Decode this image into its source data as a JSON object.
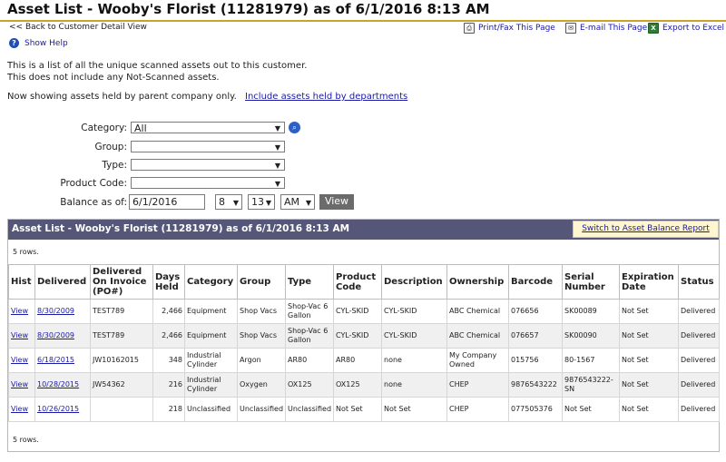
{
  "header": {
    "title": "Asset List - Wooby's Florist (11281979) as of 6/1/2016 8:13 AM",
    "back_link": "<< Back to Customer Detail View",
    "print_label": "Print/Fax This Page",
    "email_label": "E-mail This Page",
    "excel_label": "Export to Excel",
    "help_label": "Show Help"
  },
  "intro": {
    "line1": "This is a list of all the unique scanned assets out to this customer.",
    "line2": "This does not include any Not-Scanned assets.",
    "line3": "Now showing assets held by parent company only.",
    "include_link": "Include assets held by departments"
  },
  "filters": {
    "category_label": "Category:",
    "category_value": "All",
    "group_label": "Group:",
    "group_value": "",
    "type_label": "Type:",
    "type_value": "",
    "product_code_label": "Product Code:",
    "product_code_value": "",
    "balance_label": "Balance as of:",
    "balance_date": "6/1/2016",
    "hour": "8",
    "minute": "13",
    "ampm": "AM",
    "view_button": "View"
  },
  "panel": {
    "title": "Asset List - Wooby's Florist (11281979) as of 6/1/2016 8:13 AM",
    "switch_link": "Switch to Asset Balance Report",
    "rows_count_top": "5 rows.",
    "rows_count_bottom": "5 rows."
  },
  "table": {
    "headers": [
      "Hist",
      "Delivered",
      "Delivered On Invoice (PO#)",
      "Days Held",
      "Category",
      "Group",
      "Type",
      "Product Code",
      "Description",
      "Ownership",
      "Barcode",
      "Serial Number",
      "Expiration Date",
      "Status"
    ],
    "rows": [
      [
        "View",
        "8/30/2009",
        "TEST789",
        "2,466",
        "Equipment",
        "Shop Vacs",
        "Shop-Vac 6 Gallon",
        "CYL-SKID",
        "CYL-SKID",
        "ABC Chemical",
        "076656",
        "SK00089",
        "Not Set",
        "Delivered"
      ],
      [
        "View",
        "8/30/2009",
        "TEST789",
        "2,466",
        "Equipment",
        "Shop Vacs",
        "Shop-Vac 6 Gallon",
        "CYL-SKID",
        "CYL-SKID",
        "ABC Chemical",
        "076657",
        "SK00090",
        "Not Set",
        "Delivered"
      ],
      [
        "View",
        "6/18/2015",
        "JW10162015",
        "348",
        "Industrial Cylinder",
        "Argon",
        "AR80",
        "AR80",
        "none",
        "My Company Owned",
        "015756",
        "80-1567",
        "Not Set",
        "Delivered"
      ],
      [
        "View",
        "10/28/2015",
        "JW54362",
        "216",
        "Industrial Cylinder",
        "Oxygen",
        "OX125",
        "OX125",
        "none",
        "CHEP",
        "9876543222",
        "9876543222-SN",
        "Not Set",
        "Delivered"
      ],
      [
        "View",
        "10/26/2015",
        "",
        "218",
        "Unclassified",
        "Unclassified",
        "Unclassified",
        "Not Set",
        "Not Set",
        "CHEP",
        "077505376",
        "Not Set",
        "Not Set",
        "Delivered"
      ]
    ]
  }
}
